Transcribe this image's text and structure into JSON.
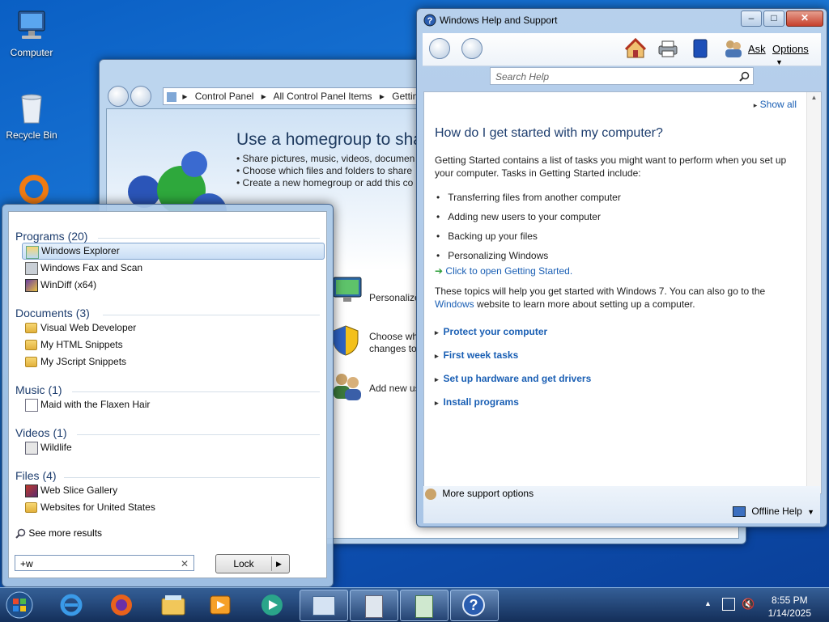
{
  "desktop": {
    "icons": [
      {
        "label": "Computer",
        "icon": "computer-icon"
      },
      {
        "label": "Recycle Bin",
        "icon": "recycle-bin-icon"
      }
    ]
  },
  "control_panel": {
    "breadcrumb": [
      "Control Panel",
      "All Control Panel Items",
      "Gettin"
    ],
    "title": "Use a homegroup to sha",
    "bullets": [
      "Share pictures, music, videos, documen",
      "Choose which files and folders to share",
      "Create a new homegroup or add this co"
    ],
    "tasks": [
      {
        "label": "Personalize",
        "icon": "monitor-icon"
      },
      {
        "label": "Choose wh\nchanges to",
        "icon": "uac-shield-icon"
      },
      {
        "label": "Add new us",
        "icon": "users-icon"
      }
    ]
  },
  "start_menu": {
    "groups": [
      {
        "heading": "Programs (20)",
        "items": [
          {
            "label": "Windows Explorer",
            "icon": "explorer-icon",
            "selected": true
          },
          {
            "label": "Windows Fax and Scan",
            "icon": "fax-icon"
          },
          {
            "label": "WinDiff (x64)",
            "icon": "windiff-icon"
          }
        ]
      },
      {
        "heading": "Documents (3)",
        "items": [
          {
            "label": "Visual Web Developer",
            "icon": "folder-icon"
          },
          {
            "label": "My HTML Snippets",
            "icon": "folder-icon"
          },
          {
            "label": "My JScript Snippets",
            "icon": "folder-icon"
          }
        ]
      },
      {
        "heading": "Music (1)",
        "items": [
          {
            "label": "Maid with the Flaxen Hair",
            "icon": "music-file-icon"
          }
        ]
      },
      {
        "heading": "Videos (1)",
        "items": [
          {
            "label": "Wildlife",
            "icon": "video-file-icon"
          }
        ]
      },
      {
        "heading": "Files (4)",
        "items": [
          {
            "label": "Web Slice Gallery",
            "icon": "web-slice-icon"
          },
          {
            "label": "Websites for United States",
            "icon": "folder-icon"
          }
        ]
      }
    ],
    "see_more": "See more results",
    "search_value": "+w",
    "lock_label": "Lock"
  },
  "help": {
    "window_title": "Windows Help and Support",
    "toolbar": {
      "ask": "Ask",
      "options": "Options"
    },
    "search_placeholder": "Search Help",
    "show_all": "Show all",
    "heading": "How do I get started with my computer?",
    "intro": "Getting Started contains a list of tasks you might want to perform when you set up your computer. Tasks in Getting Started include:",
    "bullets": [
      "Transferring files from another computer",
      "Adding new users to your computer",
      "Backing up your files",
      "Personalizing Windows"
    ],
    "open_link": "Click to open Getting Started.",
    "para_before_link": "These topics will help you get started with Windows 7. You can also go to the",
    "para_link": "Windows",
    "para_after_link": "website to learn more about setting up a computer.",
    "sections": [
      "Protect your computer",
      "First week tasks",
      "Set up hardware and get drivers",
      "Install programs"
    ],
    "more_support": "More support options",
    "offline_help": "Offline Help"
  },
  "taskbar": {
    "apps": [
      "start-orb-icon",
      "internet-explorer-icon",
      "firefox-icon",
      "file-explorer-icon",
      "media-player-icon",
      "media-center-icon",
      "control-panel-icon",
      "recycle-app-icon",
      "documents-app-icon",
      "help-app-icon"
    ],
    "time": "8:55 PM",
    "date": "1/14/2025"
  },
  "colors": {
    "link": "#1a5fb4",
    "heading": "#1d3d6e",
    "accent": "#0a5fc4"
  }
}
